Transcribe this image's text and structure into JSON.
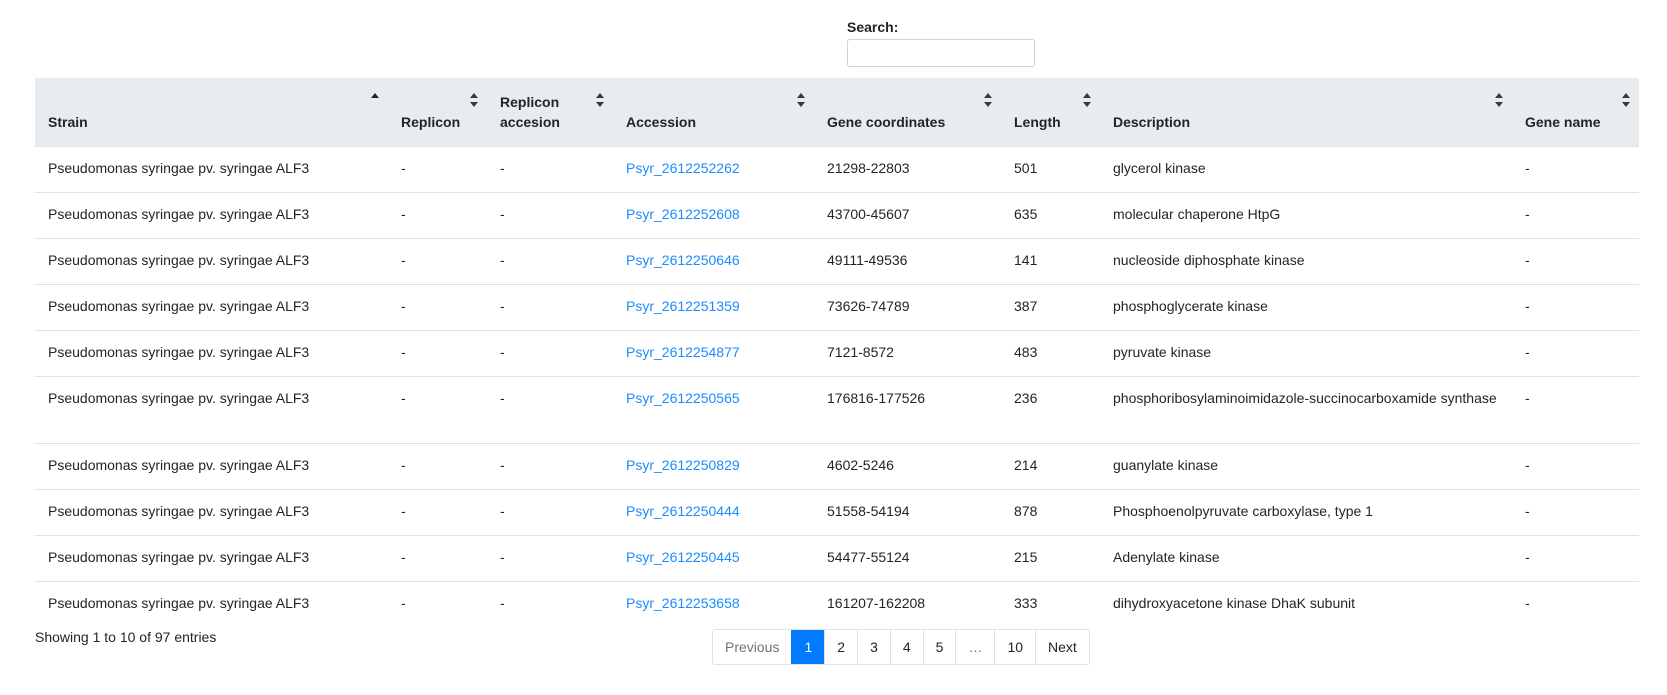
{
  "search": {
    "label": "Search:",
    "value": ""
  },
  "table": {
    "headers": [
      {
        "line1": "Strain",
        "line2": ""
      },
      {
        "line1": "Replicon",
        "line2": ""
      },
      {
        "line1": "Replicon",
        "line2": "accesion"
      },
      {
        "line1": "Accession",
        "line2": ""
      },
      {
        "line1": "Gene coordinates",
        "line2": ""
      },
      {
        "line1": "Length",
        "line2": ""
      },
      {
        "line1": "Description",
        "line2": ""
      },
      {
        "line1": "Gene name",
        "line2": ""
      }
    ],
    "rows": [
      {
        "strain": "Pseudomonas syringae pv. syringae ALF3",
        "replicon": "-",
        "replicon_accession": "-",
        "accession": "Psyr_2612252262",
        "coords": "21298-22803",
        "length": "501",
        "description": "glycerol kinase",
        "gene_name": "-"
      },
      {
        "strain": "Pseudomonas syringae pv. syringae ALF3",
        "replicon": "-",
        "replicon_accession": "-",
        "accession": "Psyr_2612252608",
        "coords": "43700-45607",
        "length": "635",
        "description": "molecular chaperone HtpG",
        "gene_name": "-"
      },
      {
        "strain": "Pseudomonas syringae pv. syringae ALF3",
        "replicon": "-",
        "replicon_accession": "-",
        "accession": "Psyr_2612250646",
        "coords": "49111-49536",
        "length": "141",
        "description": "nucleoside diphosphate kinase",
        "gene_name": "-"
      },
      {
        "strain": "Pseudomonas syringae pv. syringae ALF3",
        "replicon": "-",
        "replicon_accession": "-",
        "accession": "Psyr_2612251359",
        "coords": "73626-74789",
        "length": "387",
        "description": "phosphoglycerate kinase",
        "gene_name": "-"
      },
      {
        "strain": "Pseudomonas syringae pv. syringae ALF3",
        "replicon": "-",
        "replicon_accession": "-",
        "accession": "Psyr_2612254877",
        "coords": "7121-8572",
        "length": "483",
        "description": "pyruvate kinase",
        "gene_name": "-"
      },
      {
        "strain": "Pseudomonas syringae pv. syringae ALF3",
        "replicon": "-",
        "replicon_accession": "-",
        "accession": "Psyr_2612250565",
        "coords": "176816-177526",
        "length": "236",
        "description": "phosphoribosylaminoimidazole-succinocarboxamide synthase",
        "gene_name": "-"
      },
      {
        "strain": "Pseudomonas syringae pv. syringae ALF3",
        "replicon": "-",
        "replicon_accession": "-",
        "accession": "Psyr_2612250829",
        "coords": "4602-5246",
        "length": "214",
        "description": "guanylate kinase",
        "gene_name": "-"
      },
      {
        "strain": "Pseudomonas syringae pv. syringae ALF3",
        "replicon": "-",
        "replicon_accession": "-",
        "accession": "Psyr_2612250444",
        "coords": "51558-54194",
        "length": "878",
        "description": "Phosphoenolpyruvate carboxylase, type 1",
        "gene_name": "-"
      },
      {
        "strain": "Pseudomonas syringae pv. syringae ALF3",
        "replicon": "-",
        "replicon_accession": "-",
        "accession": "Psyr_2612250445",
        "coords": "54477-55124",
        "length": "215",
        "description": "Adenylate kinase",
        "gene_name": "-"
      },
      {
        "strain": "Pseudomonas syringae pv. syringae ALF3",
        "replicon": "-",
        "replicon_accession": "-",
        "accession": "Psyr_2612253658",
        "coords": "161207-162208",
        "length": "333",
        "description": "dihydroxyacetone kinase DhaK subunit",
        "gene_name": "-"
      }
    ]
  },
  "info": "Showing 1 to 10 of 97 entries",
  "pagination": {
    "previous": "Previous",
    "pages": [
      "1",
      "2",
      "3",
      "4",
      "5",
      "…",
      "10"
    ],
    "active": "1",
    "next": "Next"
  },
  "colors": {
    "link": "#1a8cff",
    "active_page": "#007bff",
    "header_bg": "#e9ecef"
  }
}
